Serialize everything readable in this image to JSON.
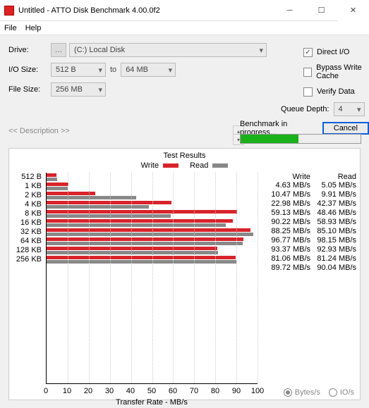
{
  "window": {
    "title": "Untitled - ATTO Disk Benchmark 4.00.0f2"
  },
  "menu": {
    "file": "File",
    "help": "Help"
  },
  "form": {
    "drive_label": "Drive:",
    "drive_value": "(C:) Local Disk",
    "io_label": "I/O Size:",
    "io_from": "512 B",
    "io_to_label": "to",
    "io_to": "64 MB",
    "file_label": "File Size:",
    "file_value": "256 MB"
  },
  "opts": {
    "direct_io": "Direct I/O",
    "bypass": "Bypass Write Cache",
    "verify": "Verify Data",
    "qd_label": "Queue Depth:",
    "qd_value": "4"
  },
  "desc": {
    "label": "<< Description >>"
  },
  "bench": {
    "status": "Benchmark in progress...",
    "cancel": "Cancel",
    "progress_pct": 48
  },
  "chart": {
    "title": "Test Results",
    "legend_write": "Write",
    "legend_read": "Read",
    "xlabel": "Transfer Rate - MB/s",
    "head_write": "Write",
    "head_read": "Read",
    "unit": "MB/s",
    "xticks": [
      0,
      10,
      20,
      30,
      40,
      50,
      60,
      70,
      80,
      90,
      100
    ],
    "radio_bytes": "Bytes/s",
    "radio_io": "IO/s"
  },
  "chart_data": {
    "type": "bar",
    "xlim": [
      0,
      100
    ],
    "xlabel": "Transfer Rate - MB/s",
    "categories": [
      "512 B",
      "1 KB",
      "2 KB",
      "4 KB",
      "8 KB",
      "16 KB",
      "32 KB",
      "64 KB",
      "128 KB",
      "256 KB"
    ],
    "series": [
      {
        "name": "Write",
        "color": "#d8232a",
        "values": [
          4.63,
          10.47,
          22.98,
          59.13,
          90.22,
          88.25,
          96.77,
          93.37,
          81.06,
          89.72
        ]
      },
      {
        "name": "Read",
        "color": "#888888",
        "values": [
          5.05,
          9.91,
          42.37,
          48.46,
          58.93,
          85.1,
          98.15,
          92.93,
          81.24,
          90.04
        ]
      }
    ]
  }
}
